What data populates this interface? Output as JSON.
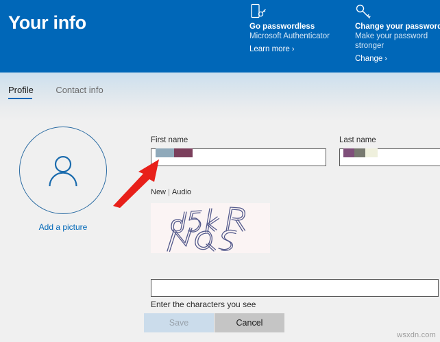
{
  "header": {
    "title": "Your info",
    "background_color": "#0067b8",
    "promos": [
      {
        "icon": "phone-key-icon",
        "title": "Go passwordless",
        "subtitle": "Microsoft Authenticator",
        "link_label": "Learn more",
        "link_chevron": "›"
      },
      {
        "icon": "key-icon",
        "title": "Change your password",
        "subtitle": "Make your password stronger",
        "link_label": "Change",
        "link_chevron": "›"
      }
    ]
  },
  "tabs": [
    {
      "label": "Profile",
      "active": true
    },
    {
      "label": "Contact info",
      "active": false
    }
  ],
  "profile": {
    "avatar_icon": "person-silhouette-icon",
    "add_picture_label": "Add a picture",
    "accent_color": "#0067b8"
  },
  "form": {
    "first_name": {
      "label": "First name",
      "value": "",
      "redacted": true,
      "redaction_colors": [
        "#8fa9ba",
        "#7b3f5c"
      ]
    },
    "last_name": {
      "label": "Last name",
      "value": "",
      "redacted": true,
      "redaction_colors": [
        "#7f4f7a",
        "#77796f",
        "#eff0dd"
      ]
    }
  },
  "captcha": {
    "new_label": "New",
    "separator": "|",
    "audio_label": "Audio",
    "challenge_text_line1": "d5kR",
    "challenge_text_line2": "NQS",
    "challenge_text": "d5kR NQS",
    "input_value": "",
    "hint": "Enter the characters you see",
    "image_background": "#fbf4f4",
    "stroke_color": "#545a8c"
  },
  "actions": {
    "save_label": "Save",
    "save_disabled": true,
    "cancel_label": "Cancel"
  },
  "annotation": {
    "type": "arrow",
    "color": "#e8201a",
    "points_to": "first-name-input"
  },
  "watermark": {
    "text": "wsxdn.com"
  }
}
